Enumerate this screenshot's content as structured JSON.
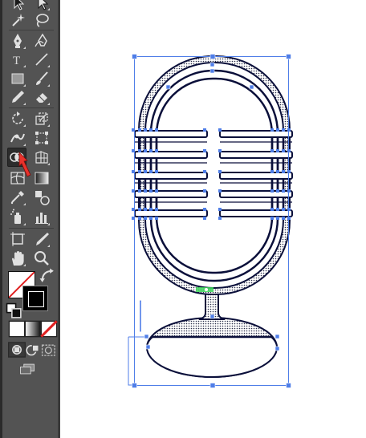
{
  "toolbar": {
    "tools": [
      {
        "name": "selection-tool-icon"
      },
      {
        "name": "direct-selection-tool-icon"
      },
      {
        "name": "magic-wand-tool-icon"
      },
      {
        "name": "lasso-tool-icon"
      },
      {
        "name": "pen-tool-icon"
      },
      {
        "name": "curvature-tool-icon"
      },
      {
        "name": "type-tool-icon",
        "glyph": "T"
      },
      {
        "name": "line-segment-tool-icon"
      },
      {
        "name": "rectangle-tool-icon"
      },
      {
        "name": "paintbrush-tool-icon"
      },
      {
        "name": "pencil-tool-icon"
      },
      {
        "name": "eraser-tool-icon"
      },
      {
        "name": "rotate-tool-icon"
      },
      {
        "name": "scale-tool-icon"
      },
      {
        "name": "width-tool-icon"
      },
      {
        "name": "free-transform-tool-icon"
      },
      {
        "name": "shape-builder-tool-icon",
        "selected": true
      },
      {
        "name": "perspective-grid-tool-icon"
      },
      {
        "name": "mesh-tool-icon"
      },
      {
        "name": "gradient-tool-icon"
      },
      {
        "name": "eyedropper-tool-icon"
      },
      {
        "name": "blend-tool-icon"
      },
      {
        "name": "symbol-sprayer-tool-icon"
      },
      {
        "name": "column-graph-tool-icon"
      },
      {
        "name": "artboard-tool-icon"
      },
      {
        "name": "slice-tool-icon"
      },
      {
        "name": "hand-tool-icon"
      },
      {
        "name": "zoom-tool-icon"
      }
    ],
    "fill_color": "#ffffff",
    "stroke_color": "#000000",
    "none_indicator_color": "#e02020",
    "color_modes": [
      "color",
      "gradient",
      "none"
    ],
    "draw_modes": [
      "draw-normal",
      "draw-behind",
      "draw-inside"
    ],
    "screen_mode": "change-screen-mode"
  },
  "cursor": {
    "color": "#e8322c"
  },
  "canvas": {
    "background": "#ffffff",
    "selection_color": "#4f7ee8",
    "artwork": "microphone",
    "artwork_stroke": "#0a0f3a",
    "smart_guide_color": "#3dd65a"
  }
}
